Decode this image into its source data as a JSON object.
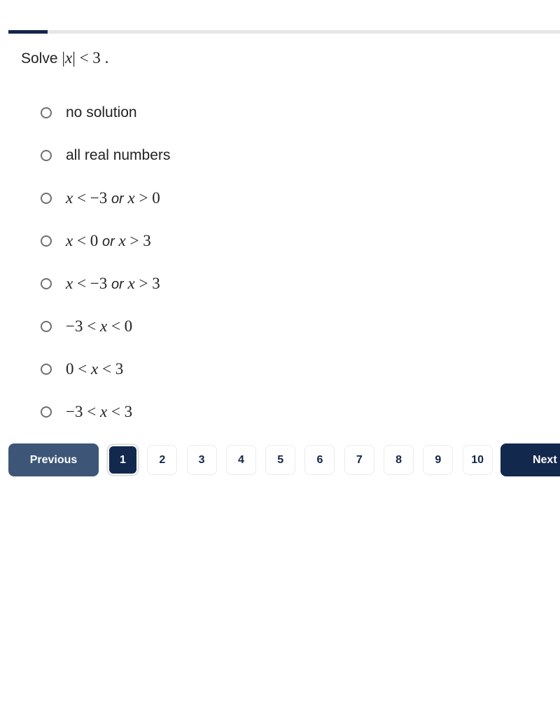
{
  "progress": {
    "current_question": 1,
    "total_questions": 10,
    "fraction_complete": 0.07
  },
  "question": {
    "prefix": "Solve",
    "expression": "|x| < 3",
    "suffix": "."
  },
  "options": [
    {
      "type": "text",
      "label": "no solution"
    },
    {
      "type": "text",
      "label": "all real numbers"
    },
    {
      "type": "math",
      "parts": [
        "x < −3 ",
        "or",
        " x > 0"
      ]
    },
    {
      "type": "math",
      "parts": [
        "x < 0 ",
        "or",
        " x > 3"
      ]
    },
    {
      "type": "math",
      "parts": [
        "x < −3 ",
        "or",
        " x > 3"
      ]
    },
    {
      "type": "math",
      "parts": [
        "−3 < x < 0"
      ]
    },
    {
      "type": "math",
      "parts": [
        "0 < x < 3"
      ]
    },
    {
      "type": "math",
      "parts": [
        "−3 < x < 3"
      ]
    }
  ],
  "pagination": {
    "previous_label": "Previous",
    "next_label": "Next",
    "pages": [
      "1",
      "2",
      "3",
      "4",
      "5",
      "6",
      "7",
      "8",
      "9",
      "10"
    ],
    "active_page": "1"
  },
  "colors": {
    "primary": "#13284d",
    "secondary": "#3d5677",
    "track": "#e6e6e6"
  }
}
